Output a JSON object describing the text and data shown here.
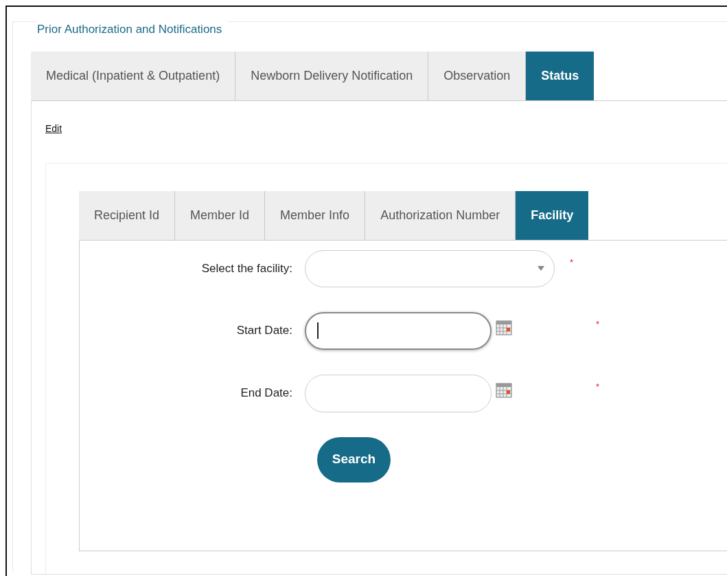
{
  "section_title": "Prior Authorization and Notifications",
  "outer_tabs": [
    {
      "label": "Medical (Inpatient & Outpatient)",
      "selected": false
    },
    {
      "label": "Newborn Delivery Notification",
      "selected": false
    },
    {
      "label": "Observation",
      "selected": false
    },
    {
      "label": "Status",
      "selected": true
    }
  ],
  "edit_link": "Edit",
  "inner_tabs": [
    {
      "label": "Recipient Id",
      "selected": false
    },
    {
      "label": "Member Id",
      "selected": false
    },
    {
      "label": "Member Info",
      "selected": false
    },
    {
      "label": "Authorization Number",
      "selected": false
    },
    {
      "label": "Facility",
      "selected": true
    }
  ],
  "fields": [
    {
      "kind": "select",
      "label": "Select the facility:",
      "required": "*"
    },
    {
      "kind": "date",
      "label": "Start Date:",
      "focused": true,
      "required": "*"
    },
    {
      "kind": "date",
      "label": "End Date:",
      "focused": false,
      "required": "*"
    }
  ],
  "search_button": "Search"
}
